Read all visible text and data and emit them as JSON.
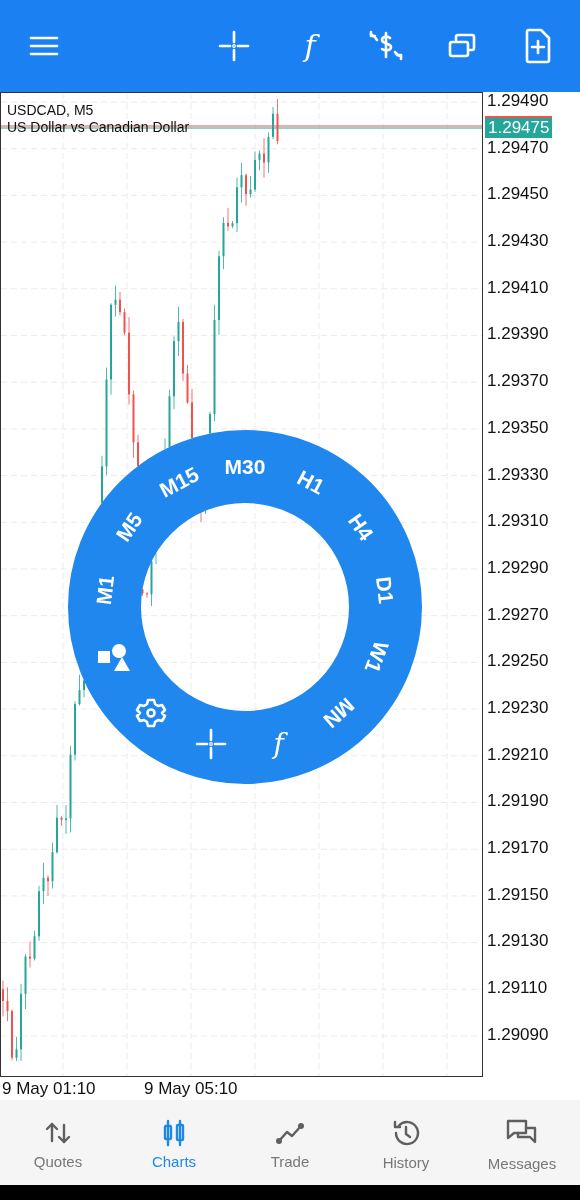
{
  "toolbar": {
    "items": [
      {
        "kind": "menu"
      },
      {
        "kind": "crosshair"
      },
      {
        "kind": "indicators",
        "label": "f"
      },
      {
        "kind": "trade"
      },
      {
        "kind": "windows"
      },
      {
        "kind": "new"
      }
    ]
  },
  "chart": {
    "symbol": "USDCAD, M5",
    "description": "US Dollar vs Canadian Dollar",
    "current_price": "1.29475",
    "price_axis": [
      "1.29490",
      "1.29470",
      "1.29450",
      "1.29430",
      "1.29410",
      "1.29390",
      "1.29370",
      "1.29350",
      "1.29330",
      "1.29310",
      "1.29290",
      "1.29270",
      "1.29250",
      "1.29230",
      "1.29210",
      "1.29190",
      "1.29170",
      "1.29150",
      "1.29130",
      "1.29110",
      "1.29090"
    ],
    "time_axis": [
      "9 May 01:10",
      "9 May 05:10"
    ]
  },
  "period_wheel": {
    "items": [
      {
        "kind": "period",
        "label": "M1"
      },
      {
        "kind": "period",
        "label": "M5"
      },
      {
        "kind": "period",
        "label": "M15"
      },
      {
        "kind": "period",
        "label": "M30"
      },
      {
        "kind": "period",
        "label": "H1"
      },
      {
        "kind": "period",
        "label": "H4"
      },
      {
        "kind": "period",
        "label": "D1"
      },
      {
        "kind": "period",
        "label": "W1"
      },
      {
        "kind": "period",
        "label": "MN"
      },
      {
        "kind": "indicators",
        "label": "f"
      },
      {
        "kind": "crosshair"
      },
      {
        "kind": "settings"
      },
      {
        "kind": "objects"
      }
    ]
  },
  "bottom_nav": [
    {
      "kind": "quotes",
      "label": "Quotes",
      "selected": false
    },
    {
      "kind": "charts",
      "label": "Charts",
      "selected": true
    },
    {
      "kind": "trade",
      "label": "Trade",
      "selected": false
    },
    {
      "kind": "history",
      "label": "History",
      "selected": false
    },
    {
      "kind": "messages",
      "label": "Messages",
      "selected": false
    }
  ]
}
